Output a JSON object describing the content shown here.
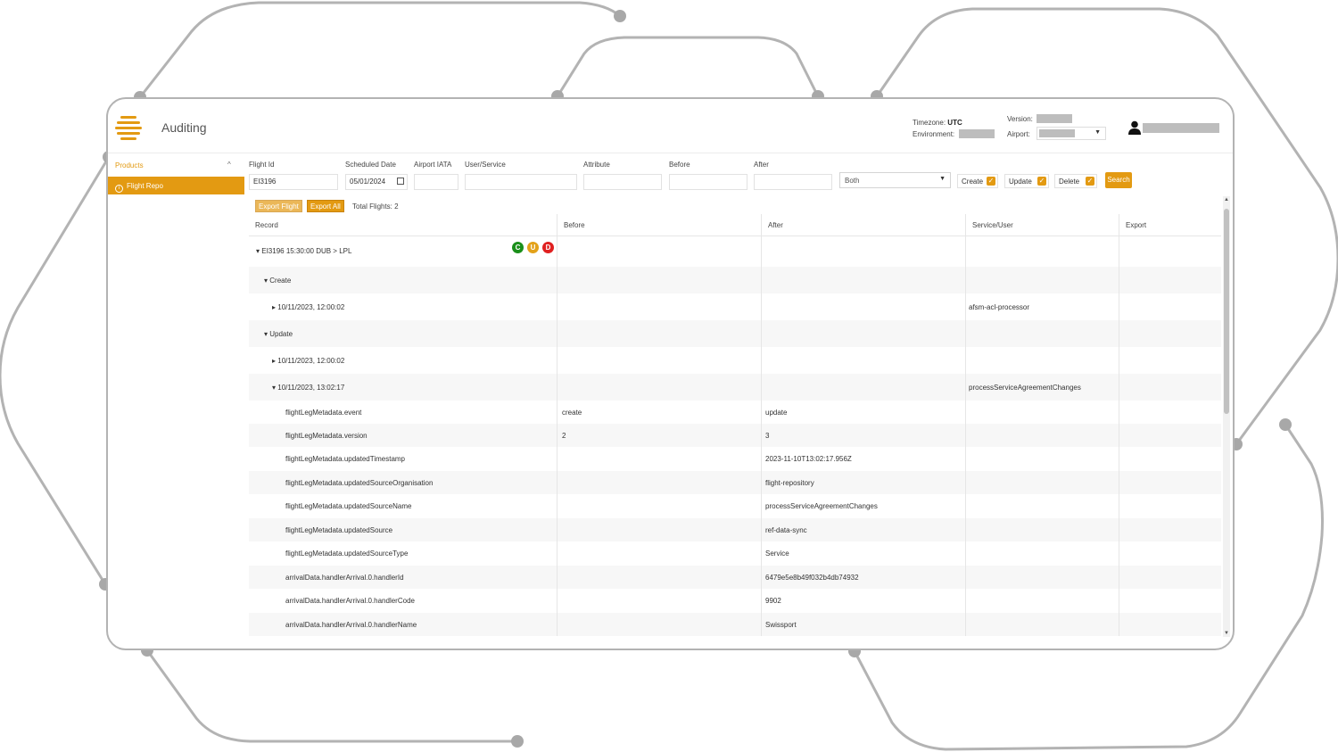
{
  "colors": {
    "accent": "#e39a12",
    "create": "#1a8f1a",
    "update": "#e3a21a",
    "delete": "#e02020"
  },
  "header": {
    "title": "Auditing",
    "timezone_label": "Timezone:",
    "timezone_value": "UTC",
    "environment_label": "Environment:",
    "version_label": "Version:",
    "airport_label": "Airport:"
  },
  "sidebar": {
    "section": "Products",
    "items": [
      {
        "label": "Flight Repo",
        "icon": "info-circle-icon"
      }
    ]
  },
  "filters": {
    "flight_id": {
      "label": "Flight Id",
      "value": "EI3196"
    },
    "scheduled_date": {
      "label": "Scheduled Date",
      "value": "05/01/2024"
    },
    "airport_iata": {
      "label": "Airport IATA",
      "value": ""
    },
    "user_service": {
      "label": "User/Service",
      "value": ""
    },
    "attribute": {
      "label": "Attribute",
      "value": ""
    },
    "before": {
      "label": "Before",
      "value": ""
    },
    "after": {
      "label": "After",
      "value": ""
    },
    "mode": {
      "value": "Both"
    },
    "create": {
      "label": "Create",
      "checked": true
    },
    "update": {
      "label": "Update",
      "checked": true
    },
    "delete": {
      "label": "Delete",
      "checked": true
    },
    "search_label": "Search"
  },
  "toolbar": {
    "export_flight": "Export Flight",
    "export_all": "Export All",
    "total_flights": "Total Flights: 2"
  },
  "grid": {
    "columns": [
      "Record",
      "Before",
      "After",
      "Service/User",
      "Export"
    ],
    "flight": {
      "record": "EI3196 15:30:00 DUB > LPL",
      "badges": [
        "C",
        "U",
        "D"
      ]
    },
    "groups": {
      "create": "Create",
      "update": "Update"
    },
    "events": [
      {
        "timestamp": "10/11/2023, 12:00:02",
        "service": "afsm-acl-processor"
      },
      {
        "timestamp": "10/11/2023, 12:00:02",
        "service": ""
      },
      {
        "timestamp": "10/11/2023, 13:02:17",
        "service": "processServiceAgreementChanges"
      }
    ],
    "changes": [
      {
        "attribute": "flightLegMetadata.event",
        "before": "create",
        "after": "update"
      },
      {
        "attribute": "flightLegMetadata.version",
        "before": "2",
        "after": "3"
      },
      {
        "attribute": "flightLegMetadata.updatedTimestamp",
        "before": "",
        "after": "2023-11-10T13:02:17.956Z"
      },
      {
        "attribute": "flightLegMetadata.updatedSourceOrganisation",
        "before": "",
        "after": "flight-repository"
      },
      {
        "attribute": "flightLegMetadata.updatedSourceName",
        "before": "",
        "after": "processServiceAgreementChanges"
      },
      {
        "attribute": "flightLegMetadata.updatedSource",
        "before": "",
        "after": "ref-data-sync"
      },
      {
        "attribute": "flightLegMetadata.updatedSourceType",
        "before": "",
        "after": "Service"
      },
      {
        "attribute": "arrivalData.handlerArrival.0.handlerId",
        "before": "",
        "after": "6479e5e8b49f032b4db74932"
      },
      {
        "attribute": "arrivalData.handlerArrival.0.handlerCode",
        "before": "",
        "after": "9902"
      },
      {
        "attribute": "arrivalData.handlerArrival.0.handlerName",
        "before": "",
        "after": "Swissport"
      }
    ]
  }
}
